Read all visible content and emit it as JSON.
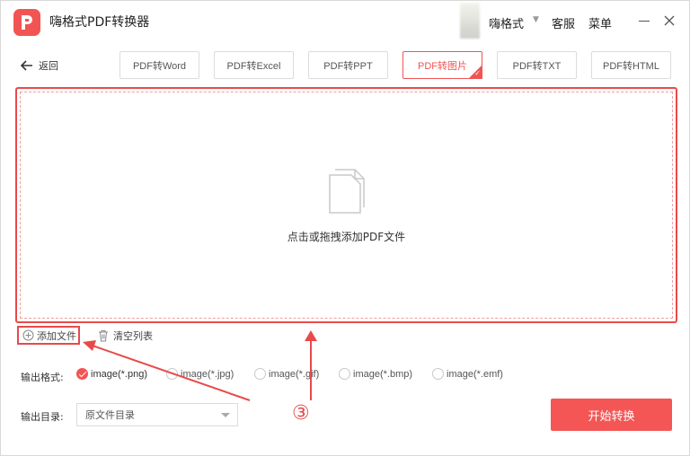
{
  "app": {
    "title": "嗨格式PDF转换器",
    "user_name": "嗨格式",
    "service": "客服",
    "menu": "菜单"
  },
  "toolbar": {
    "back_label": "返回",
    "tabs": [
      {
        "label": "PDF转Word"
      },
      {
        "label": "PDF转Excel"
      },
      {
        "label": "PDF转PPT"
      },
      {
        "label": "PDF转图片",
        "active": true
      },
      {
        "label": "PDF转TXT"
      },
      {
        "label": "PDF转HTML"
      }
    ]
  },
  "dropzone": {
    "hint": "点击或拖拽添加PDF文件"
  },
  "actions": {
    "add_file": "添加文件",
    "clear_list": "清空列表"
  },
  "format": {
    "label": "输出格式:",
    "options": [
      {
        "label": "image(*.png)",
        "checked": true
      },
      {
        "label": "image(*.jpg)",
        "checked": false
      },
      {
        "label": "image(*.gif)",
        "checked": false
      },
      {
        "label": "image(*.bmp)",
        "checked": false
      },
      {
        "label": "image(*.emf)",
        "checked": false
      }
    ]
  },
  "output_dir": {
    "label": "输出目录:",
    "value": "原文件目录"
  },
  "start_button": "开始转换",
  "annotation": {
    "step": "③"
  },
  "colors": {
    "accent": "#f25454",
    "annotation": "#e84a4a"
  },
  "icons": [
    "app-logo-icon",
    "back-arrow-icon",
    "file-icon",
    "plus-circle-icon",
    "trash-icon",
    "close-icon",
    "minimize-icon"
  ]
}
